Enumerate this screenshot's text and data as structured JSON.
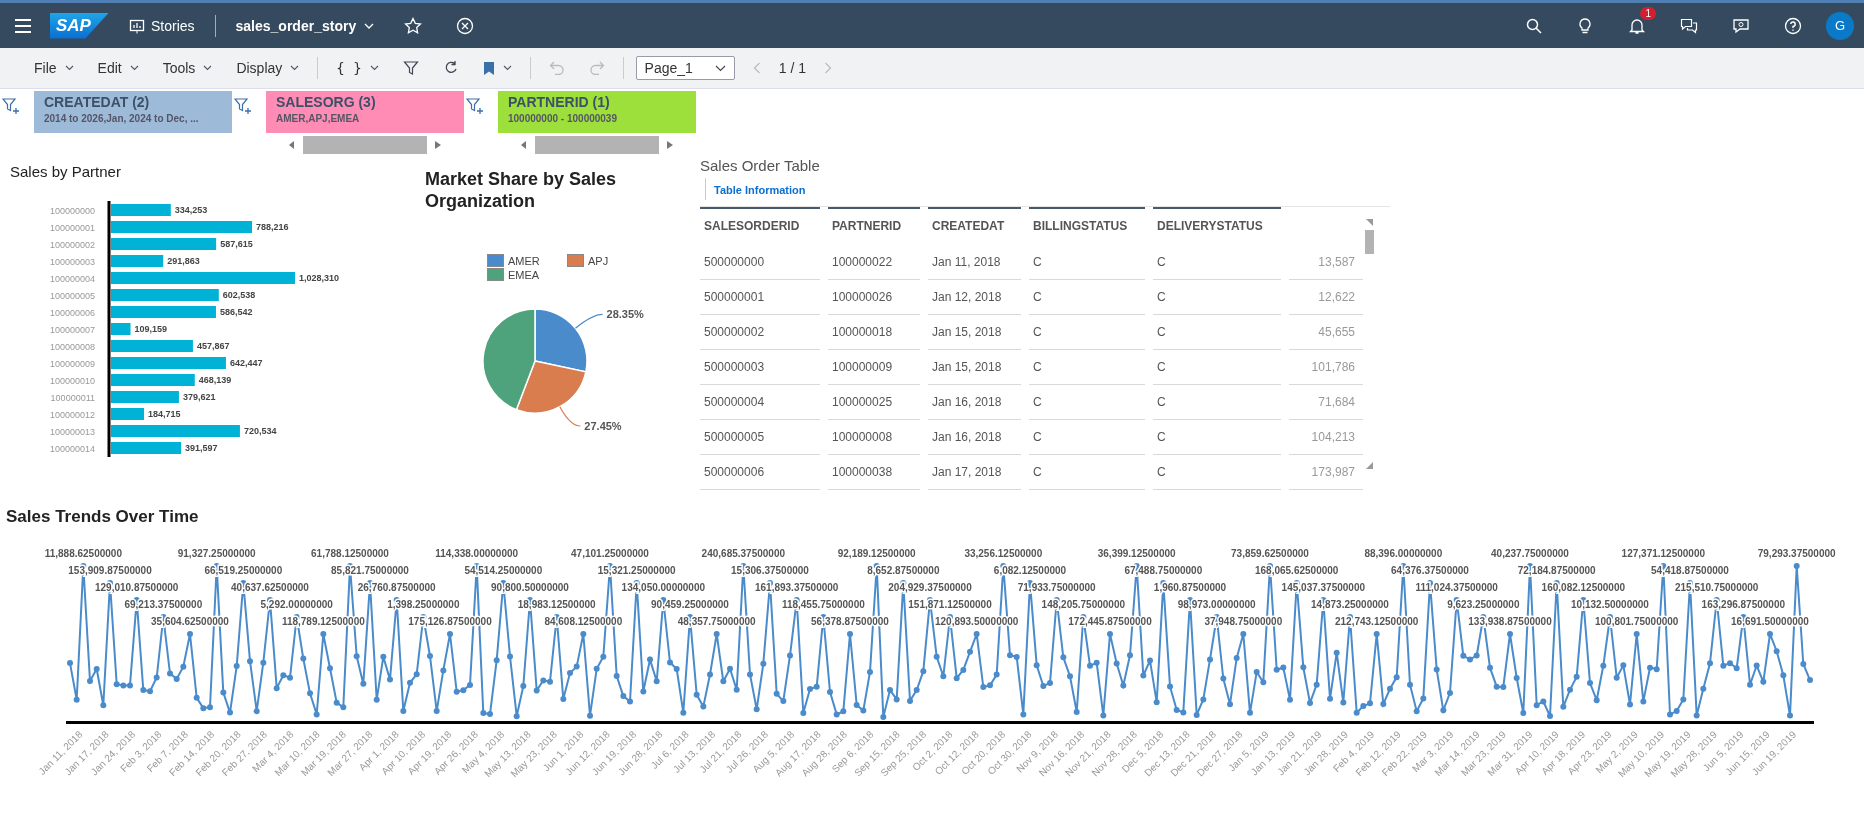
{
  "shell": {
    "logo": "SAP",
    "app": "Stories",
    "story": "sales_order_story",
    "notifications": "1",
    "avatar": "G"
  },
  "toolbar": {
    "menus": [
      "File",
      "Edit",
      "Tools",
      "Display"
    ],
    "formula": "{ }",
    "history": [
      {
        "kind": "undo",
        "disabled": true
      },
      {
        "kind": "redo",
        "disabled": true
      }
    ],
    "page": "Page_1",
    "page_count": "1 / 1",
    "prev_disabled": true,
    "next_disabled": true
  },
  "filters": [
    {
      "title": "CREATEDAT (2)",
      "values": "2014 to 2026,Jan, 2024 to Dec, ...",
      "color": "#9dbbd9",
      "scrollbar": false
    },
    {
      "title": "SALESORG (3)",
      "values": "AMER,APJ,EMEA",
      "color": "#ff8cb5",
      "scrollbar": true
    },
    {
      "title": "PARTNERID (1)",
      "values": "100000000 - 100000039",
      "color": "#9de03c",
      "scrollbar": true
    }
  ],
  "partner": {
    "chart_data": {
      "type": "bar",
      "orientation": "horizontal",
      "title": "Sales by Partner",
      "categories": [
        "100000000",
        "100000001",
        "100000002",
        "100000003",
        "100000004",
        "100000005",
        "100000006",
        "100000007",
        "100000008",
        "100000009",
        "100000010",
        "100000011",
        "100000012",
        "100000013",
        "100000014"
      ],
      "series": [
        {
          "color": "#00b2d6",
          "values": [
            334253,
            788216,
            587615,
            291863,
            1028310,
            602538,
            586542,
            109159,
            457867,
            642447,
            468139,
            379621,
            184715,
            720534,
            391597
          ],
          "value_labels": [
            "334,253",
            "788,216",
            "587,615",
            "291,863",
            "1,028,310",
            "602,538",
            "586,542",
            "109,159",
            "457,867",
            "642,447",
            "468,139",
            "379,621",
            "184,715",
            "720,534",
            "391,597"
          ]
        }
      ],
      "data_labels": true
    }
  },
  "market": {
    "chart_data": {
      "type": "pie",
      "title": "Market Share by Sales Organization",
      "categories": [
        "AMER",
        "APJ",
        "EMEA"
      ],
      "series": [
        {
          "values": [
            28.35,
            27.45,
            44.2
          ]
        }
      ],
      "colors": [
        "#4a8bcb",
        "#d97c4e",
        "#4fa37c"
      ],
      "value_labels": [
        "28.35%",
        "27.45%",
        null
      ]
    }
  },
  "table": {
    "title": "Sales Order Table",
    "info_link": "Table Information",
    "columns": [
      "SALESORDERID",
      "PARTNERID",
      "CREATEDAT",
      "BILLINGSTATUS",
      "DELIVERYSTATUS"
    ],
    "rows": [
      [
        "500000000",
        "100000022",
        "Jan 11, 2018",
        "C",
        "C",
        "13,587"
      ],
      [
        "500000001",
        "100000026",
        "Jan 12, 2018",
        "C",
        "C",
        "12,622"
      ],
      [
        "500000002",
        "100000018",
        "Jan 15, 2018",
        "C",
        "C",
        "45,655"
      ],
      [
        "500000003",
        "100000009",
        "Jan 15, 2018",
        "C",
        "C",
        "101,786"
      ],
      [
        "500000004",
        "100000025",
        "Jan 16, 2018",
        "C",
        "C",
        "71,684"
      ],
      [
        "500000005",
        "100000008",
        "Jan 16, 2018",
        "C",
        "C",
        "104,213"
      ],
      [
        "500000006",
        "100000038",
        "Jan 17, 2018",
        "C",
        "C",
        "173,987"
      ]
    ]
  },
  "trend": {
    "title": "Sales Trends Over Time",
    "x_labels": [
      "Jan 11, 2018",
      "Jan 17, 2018",
      "Jan 24, 2018",
      "Feb 3, 2018",
      "Feb 7, 2018",
      "Feb 14, 2018",
      "Feb 20, 2018",
      "Feb 27, 2018",
      "Mar 4, 2018",
      "Mar 10, 2018",
      "Mar 19, 2018",
      "Mar 27, 2018",
      "Apr 1, 2018",
      "Apr 10, 2018",
      "Apr 19, 2018",
      "Apr 26, 2018",
      "May 4, 2018",
      "May 13, 2018",
      "May 23, 2018",
      "Jun 1, 2018",
      "Jun 12, 2018",
      "Jun 19, 2018",
      "Jun 28, 2018",
      "Jul 6, 2018",
      "Jul 13, 2018",
      "Jul 21, 2018",
      "Jul 26, 2018",
      "Aug 5, 2018",
      "Aug 17, 2018",
      "Aug 28, 2018",
      "Sep 6, 2018",
      "Sep 15, 2018",
      "Sep 25, 2018",
      "Oct 2, 2018",
      "Oct 12, 2018",
      "Oct 20, 2018",
      "Oct 30, 2018",
      "Nov 9, 2018",
      "Nov 16, 2018",
      "Nov 21, 2018",
      "Nov 28, 2018",
      "Dec 5, 2018",
      "Dec 13, 2018",
      "Dec 21, 2018",
      "Dec 27, 2018",
      "Jan 5, 2019",
      "Jan 13, 2019",
      "Jan 21, 2019",
      "Jan 28, 2019",
      "Feb 4, 2019",
      "Feb 12, 2019",
      "Feb 22, 2019",
      "Mar 3, 2019",
      "Mar 14, 2019",
      "Mar 23, 2019",
      "Mar 31, 2019",
      "Apr 10, 2019",
      "Apr 18, 2019",
      "Apr 23, 2019",
      "May 2, 2019",
      "May 10, 2019",
      "May 19, 2019",
      "May 28, 2019",
      "Jun 5, 2019",
      "Jun 15, 2019",
      "Jun 19, 2019"
    ],
    "point_labels": [
      "11,888.62500000",
      "91,327.25000000",
      "61,788.12500000",
      "114,338.00000000",
      "47,101.25000000",
      "240,685.37500000",
      "92,189.12500000",
      "33,256.12500000",
      "36,399.12500000",
      "73,859.62500000",
      "88,396.00000000",
      "40,237.75000000",
      "127,371.12500000",
      "79,293.37500000",
      "153,909.87500000",
      "66,519.25000000",
      "85,821.75000000",
      "54,514.25000000",
      "15,321.25000000",
      "15,306.37500000",
      "8,652.87500000",
      "6,082.12500000",
      "67,488.75000000",
      "168,065.62500000",
      "64,376.37500000",
      "72,184.87500000",
      "54,418.87500000",
      "129,010.87500000",
      "40,637.62500000",
      "26,760.87500000",
      "90,800.50000000",
      "134,050.00000000",
      "161,893.37500000",
      "204,929.37500000",
      "71,933.75000000",
      "1,960.87500000",
      "145,037.37500000",
      "111,024.37500000",
      "160,082.12500000",
      "215,510.75000000",
      "69,213.37500000",
      "5,292.00000000",
      "1,398.25000000",
      "18,983.12500000",
      "90,459.25000000",
      "118,455.75000000",
      "151,871.12500000",
      "148,205.75000000",
      "98,973.00000000",
      "14,873.25000000",
      "9,623.25000000",
      "10,132.50000000",
      "163,296.87500000",
      "35,604.62500000",
      "118,789.12500000",
      "175,126.87500000",
      "84,608.12500000",
      "48,357.75000000",
      "56,378.87500000",
      "120,893.50000000",
      "172,445.87500000",
      "37,948.75000000",
      "212,743.12500000",
      "133,938.87500000",
      "100,801.75000000",
      "16,691.50000000"
    ]
  }
}
